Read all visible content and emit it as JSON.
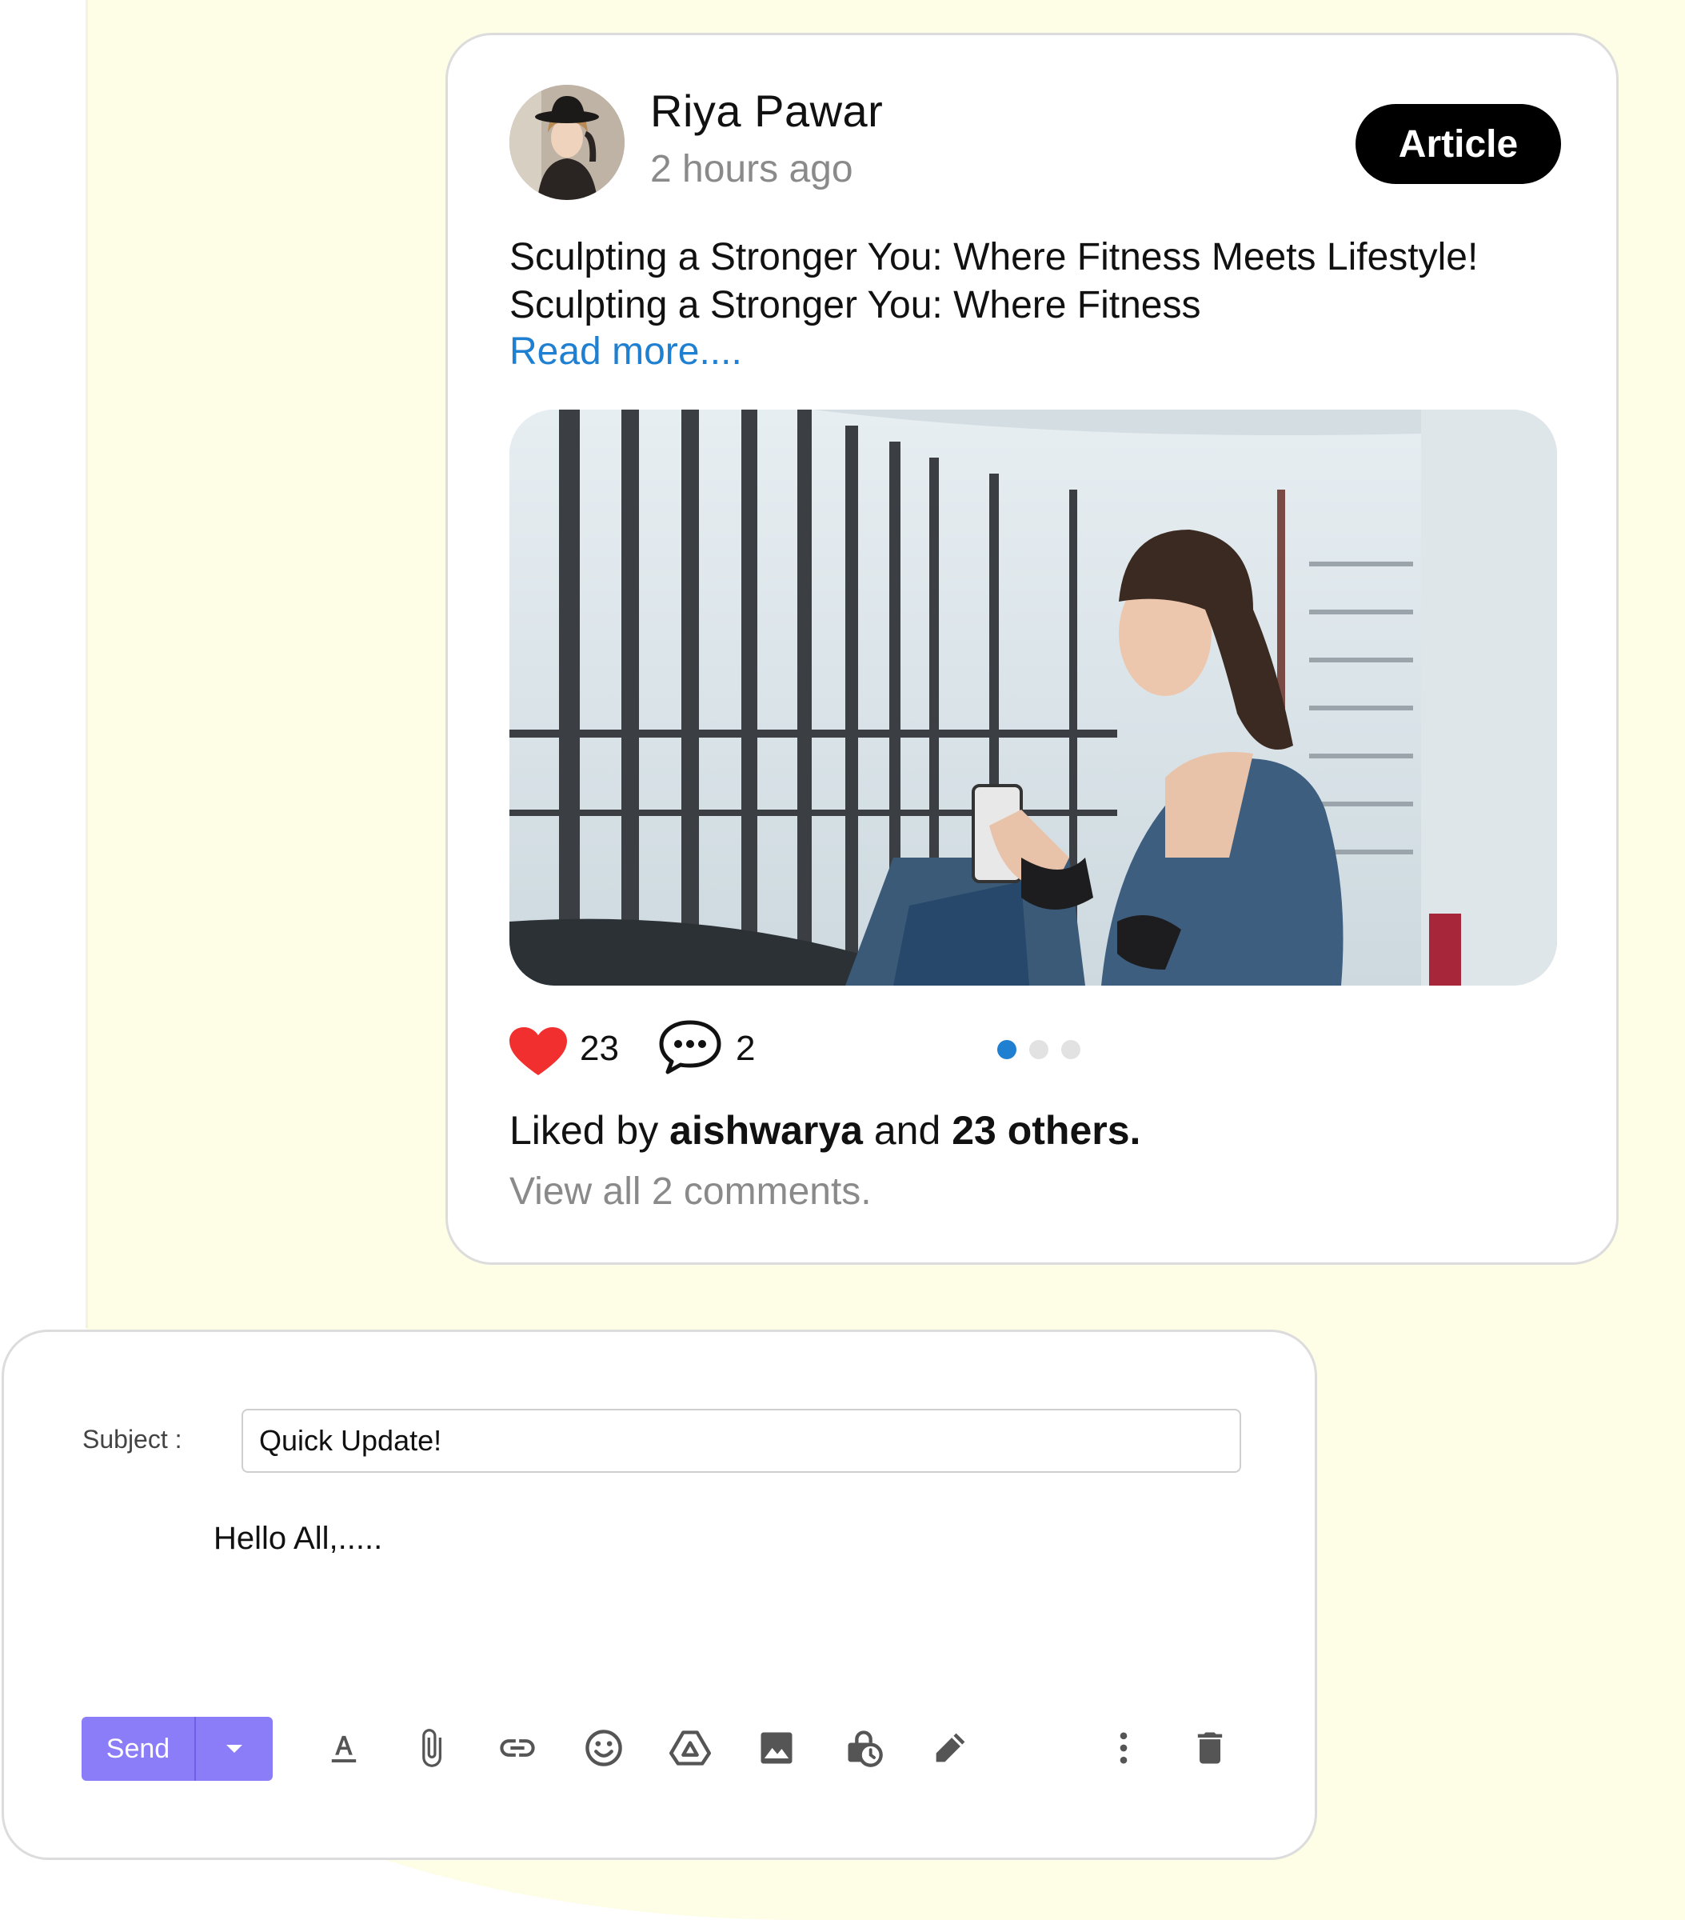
{
  "post": {
    "author": "Riya Pawar",
    "timestamp": "2 hours ago",
    "badge": "Article",
    "text": "Sculpting a Stronger You: Where Fitness Meets Lifestyle! Sculpting a Stronger You: Where Fitness",
    "read_more": "Read more....",
    "likes": "23",
    "comments": "2",
    "carousel": {
      "total": 3,
      "active": 1
    },
    "liked_prefix": "Liked by",
    "liked_user": "aishwarya",
    "liked_and": "and",
    "liked_others": "23 others.",
    "view_comments": "View all 2 comments."
  },
  "compose": {
    "subject_label": "Subject :",
    "subject_value": "Quick Update!",
    "body": "Hello All,.....",
    "send_label": "Send",
    "tools": [
      "text-format-icon",
      "attach-icon",
      "link-icon",
      "emoji-icon",
      "drive-icon",
      "image-icon",
      "confidential-mode-icon",
      "signature-icon",
      "more-options-icon",
      "delete-icon"
    ]
  },
  "colors": {
    "accent": "#8b7df7",
    "link": "#1f7fd1",
    "like": "#f22f2f",
    "background": "#fefde6"
  }
}
